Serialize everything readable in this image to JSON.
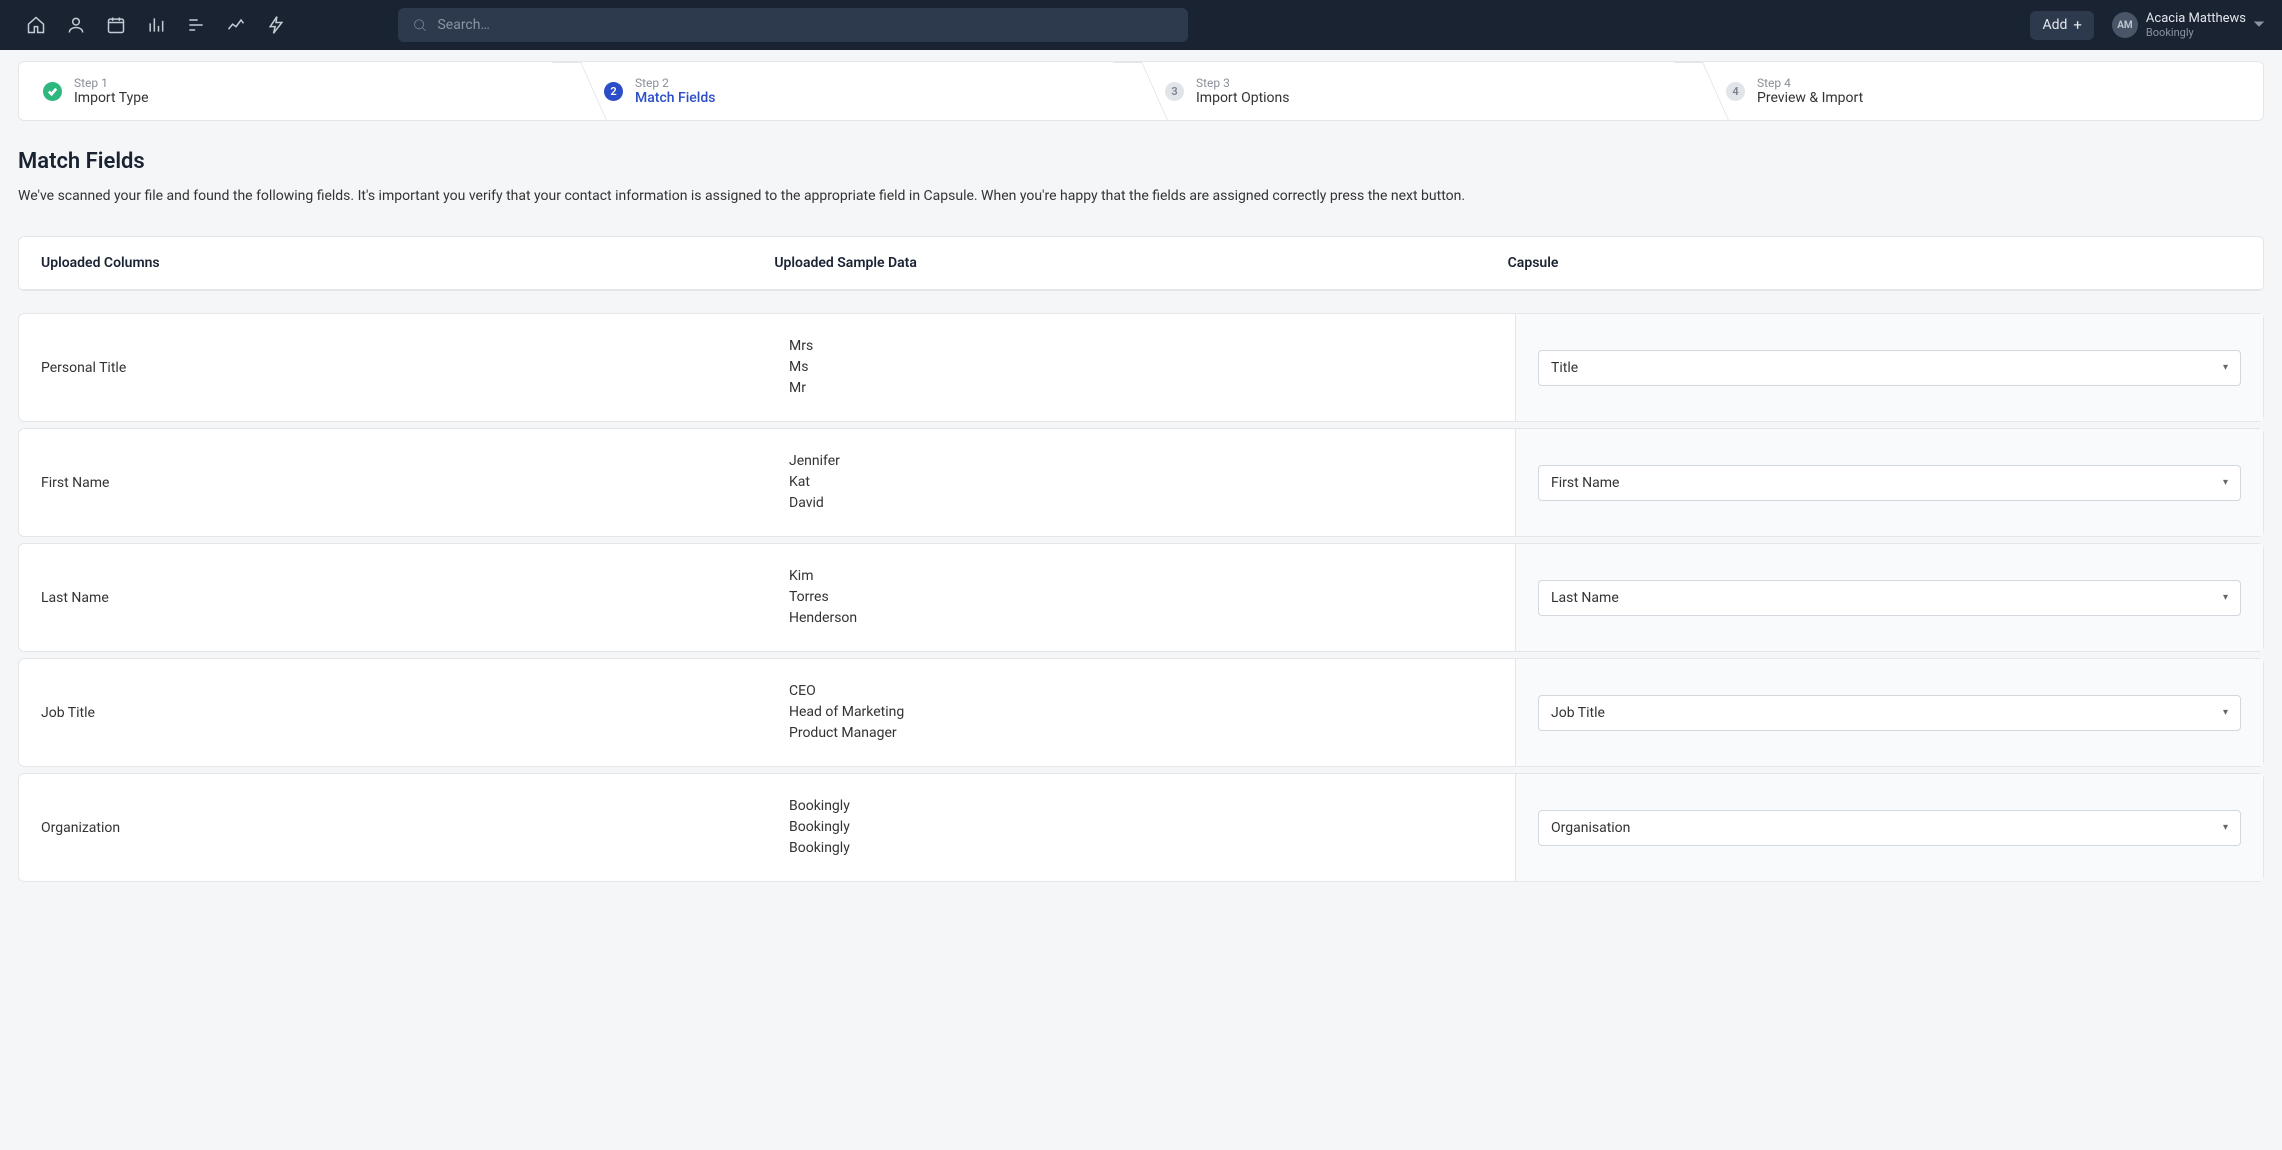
{
  "header": {
    "search_placeholder": "Search…",
    "add_label": "Add"
  },
  "user": {
    "initials": "AM",
    "name": "Acacia Matthews",
    "org": "Bookingly"
  },
  "steps": [
    {
      "label": "Step 1",
      "title": "Import Type",
      "state": "done"
    },
    {
      "label": "Step 2",
      "title": "Match Fields",
      "state": "active",
      "num": "2"
    },
    {
      "label": "Step 3",
      "title": "Import Options",
      "state": "pending",
      "num": "3"
    },
    {
      "label": "Step 4",
      "title": "Preview & Import",
      "state": "pending",
      "num": "4"
    }
  ],
  "page": {
    "title": "Match Fields",
    "description": "We've scanned your file and found the following fields. It's important you verify that your contact information is assigned to the appropriate field in Capsule. When you're happy that the fields are assigned correctly press the next button."
  },
  "table_headers": {
    "uploaded_columns": "Uploaded Columns",
    "sample_data": "Uploaded Sample Data",
    "capsule": "Capsule"
  },
  "fields": [
    {
      "name": "Personal Title",
      "samples": [
        "Mrs",
        "Ms",
        "Mr"
      ],
      "mapped": "Title"
    },
    {
      "name": "First Name",
      "samples": [
        "Jennifer",
        "Kat",
        "David"
      ],
      "mapped": "First Name"
    },
    {
      "name": "Last Name",
      "samples": [
        "Kim",
        "Torres",
        "Henderson"
      ],
      "mapped": "Last Name"
    },
    {
      "name": "Job Title",
      "samples": [
        "CEO",
        "Head of Marketing",
        "Product Manager"
      ],
      "mapped": "Job Title"
    },
    {
      "name": "Organization",
      "samples": [
        "Bookingly",
        "Bookingly",
        "Bookingly"
      ],
      "mapped": "Organisation"
    }
  ]
}
